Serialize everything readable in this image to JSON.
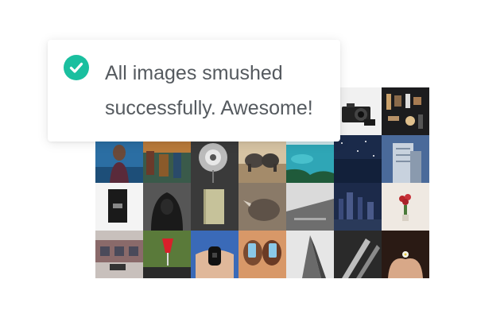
{
  "toast": {
    "icon": "check-circle-icon",
    "icon_color": "#1ABF9F",
    "message": "All images smushed successfully. Awesome!"
  },
  "gallery": {
    "tiles": [
      {
        "icon": "blank-thumbnail"
      },
      {
        "icon": "blank-thumbnail"
      },
      {
        "icon": "blank-thumbnail"
      },
      {
        "icon": "blank-thumbnail"
      },
      {
        "icon": "blank-thumbnail"
      },
      {
        "icon": "camera-photo-thumbnail"
      },
      {
        "icon": "grooming-kit-photo-thumbnail"
      },
      {
        "icon": "woman-photo-thumbnail"
      },
      {
        "icon": "boats-photo-thumbnail"
      },
      {
        "icon": "flower-photo-thumbnail"
      },
      {
        "icon": "elephants-photo-thumbnail"
      },
      {
        "icon": "coast-photo-thumbnail"
      },
      {
        "icon": "night-sky-photo-thumbnail"
      },
      {
        "icon": "building-photo-thumbnail"
      },
      {
        "icon": "book-photo-thumbnail"
      },
      {
        "icon": "hooded-figure-photo-thumbnail"
      },
      {
        "icon": "notebook-photo-thumbnail"
      },
      {
        "icon": "rhino-photo-thumbnail"
      },
      {
        "icon": "rooftop-photo-thumbnail"
      },
      {
        "icon": "city-night-photo-thumbnail"
      },
      {
        "icon": "roses-photo-thumbnail"
      },
      {
        "icon": "storefront-photo-thumbnail"
      },
      {
        "icon": "red-drink-photo-thumbnail"
      },
      {
        "icon": "fitness-band-photo-thumbnail"
      },
      {
        "icon": "two-women-photo-thumbnail"
      },
      {
        "icon": "skyscraper-photo-thumbnail"
      },
      {
        "icon": "window-shadow-photo-thumbnail"
      },
      {
        "icon": "hands-flower-photo-thumbnail"
      }
    ]
  }
}
